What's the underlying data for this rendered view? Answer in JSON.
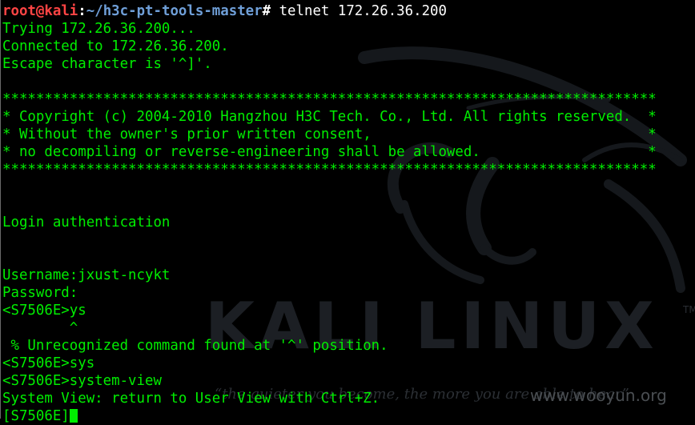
{
  "prompt": {
    "user": "root",
    "at": "@",
    "host": "kali",
    "sep": ":",
    "path": "~/h3c-pt-tools-master",
    "symbol": "#",
    "command": " telnet 172.26.36.200"
  },
  "output_lines": [
    "Trying 172.26.36.200...",
    "Connected to 172.26.36.200.",
    "Escape character is '^]'.",
    "",
    "******************************************************************************",
    "* Copyright (c) 2004-2010 Hangzhou H3C Tech. Co., Ltd. All rights reserved.  *",
    "* Without the owner's prior written consent,                                 *",
    "* no decompiling or reverse-engineering shall be allowed.                    *",
    "******************************************************************************",
    "",
    "",
    "Login authentication",
    "",
    "",
    "Username:jxust-ncykt",
    "Password:",
    "<S7506E>ys",
    "        ^",
    " % Unrecognized command found at '^' position.",
    "<S7506E>sys",
    "<S7506E>system-view",
    "System View: return to User View with Ctrl+Z."
  ],
  "current_prompt": "[S7506E]",
  "watermark": {
    "logo": "KALI LINUX",
    "tm": "TM",
    "quote": "“the quieter you become, the more you are able to hear”",
    "site": "www.wooyun.org"
  },
  "colors": {
    "background": "#000000",
    "text": "#00ee00",
    "prompt_user": "#ff4444",
    "prompt_path": "#6f9fd8"
  }
}
